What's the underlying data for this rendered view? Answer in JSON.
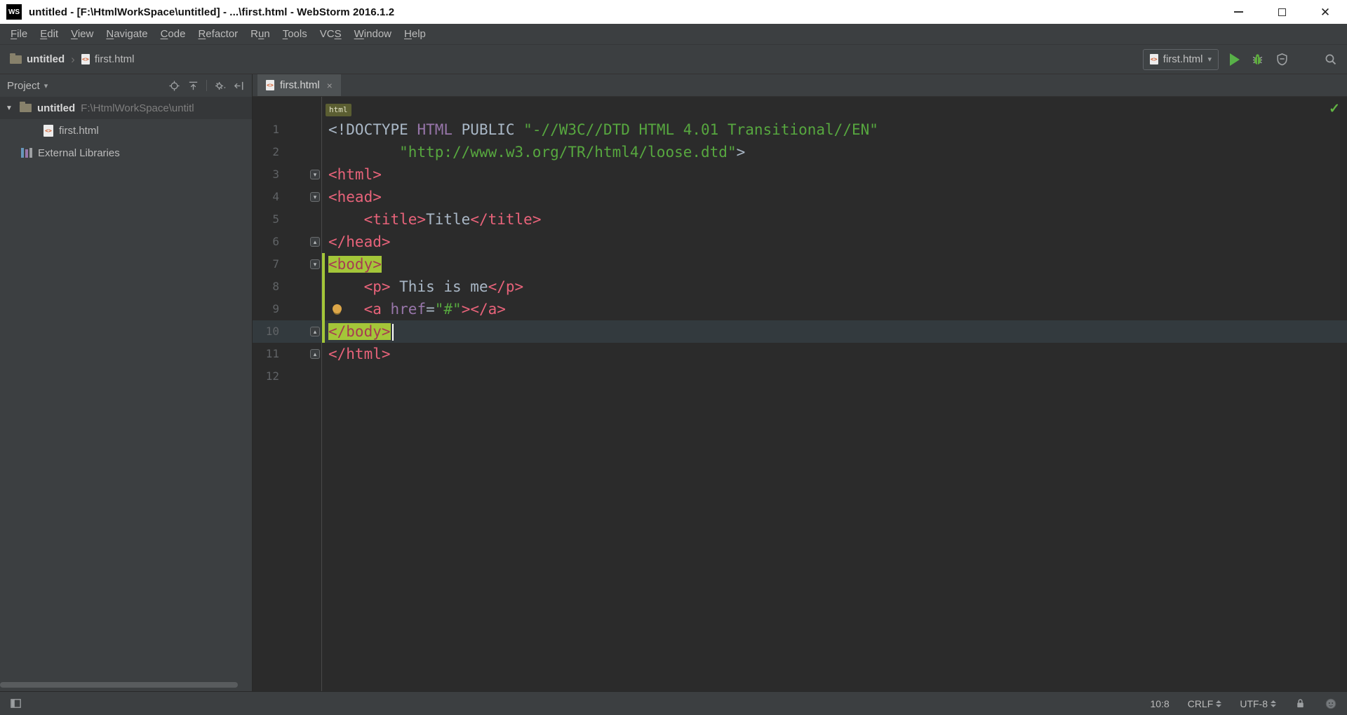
{
  "window": {
    "logo": "WS",
    "title": "untitled - [F:\\HtmlWorkSpace\\untitled] - ...\\first.html - WebStorm 2016.1.2"
  },
  "menu": {
    "items": [
      {
        "label": "File",
        "u": 0
      },
      {
        "label": "Edit",
        "u": 0
      },
      {
        "label": "View",
        "u": 0
      },
      {
        "label": "Navigate",
        "u": 0
      },
      {
        "label": "Code",
        "u": 0
      },
      {
        "label": "Refactor",
        "u": 0
      },
      {
        "label": "Run",
        "u": 1
      },
      {
        "label": "Tools",
        "u": 0
      },
      {
        "label": "VCS",
        "u": 2
      },
      {
        "label": "Window",
        "u": 0
      },
      {
        "label": "Help",
        "u": 0
      }
    ]
  },
  "navbar": {
    "breadcrumbs": [
      {
        "label": "untitled",
        "icon": "folder-icon"
      },
      {
        "label": "first.html",
        "icon": "html-file-icon"
      }
    ],
    "run_config": {
      "label": "first.html"
    }
  },
  "project": {
    "title": "Project",
    "tree": [
      {
        "name": "untitled",
        "path": "F:\\HtmlWorkSpace\\untitl",
        "type": "folder",
        "expanded": true,
        "selected": true
      },
      {
        "name": "first.html",
        "type": "html-file"
      },
      {
        "name": "External Libraries",
        "type": "library"
      }
    ]
  },
  "editor": {
    "tab": {
      "label": "first.html"
    },
    "breadcrumb": "html",
    "lines": [
      {
        "n": 1,
        "tokens": [
          [
            "<!DOCTYPE ",
            "pl"
          ],
          [
            "HTML",
            "kw"
          ],
          [
            " PUBLIC ",
            "pl"
          ],
          [
            "\"-//W3C//DTD HTML 4.01 Transitional//EN\"",
            "str"
          ]
        ]
      },
      {
        "n": 2,
        "tokens": [
          [
            "        ",
            "pl"
          ],
          [
            "\"http://www.w3.org/TR/html4/loose.dtd\"",
            "str"
          ],
          [
            ">",
            "pl"
          ]
        ]
      },
      {
        "n": 3,
        "fold": "open",
        "tokens": [
          [
            "<html>",
            "tag"
          ]
        ]
      },
      {
        "n": 4,
        "fold": "open",
        "tokens": [
          [
            "<head>",
            "tag"
          ]
        ]
      },
      {
        "n": 5,
        "tokens": [
          [
            "    ",
            "pl"
          ],
          [
            "<title>",
            "tag"
          ],
          [
            "Title",
            "pl"
          ],
          [
            "</title>",
            "tag"
          ]
        ]
      },
      {
        "n": 6,
        "fold": "close",
        "tokens": [
          [
            "</head>",
            "tag"
          ]
        ]
      },
      {
        "n": 7,
        "fold": "open",
        "bar": true,
        "tokens": [
          [
            "<body>",
            "hl"
          ]
        ]
      },
      {
        "n": 8,
        "bar": true,
        "tokens": [
          [
            "    ",
            "pl"
          ],
          [
            "<p>",
            "tag"
          ],
          [
            " This is me",
            "pl"
          ],
          [
            "</p>",
            "tag"
          ]
        ]
      },
      {
        "n": 9,
        "bar": true,
        "bulb": true,
        "tokens": [
          [
            "    ",
            "pl"
          ],
          [
            "<a ",
            "tag"
          ],
          [
            "href",
            "attr"
          ],
          [
            "=",
            "pl"
          ],
          [
            "\"#\"",
            "str"
          ],
          [
            "></a>",
            "tag"
          ]
        ]
      },
      {
        "n": 10,
        "fold": "close",
        "bar": true,
        "current": true,
        "caret": true,
        "tokens": [
          [
            "</body>",
            "hl"
          ]
        ]
      },
      {
        "n": 11,
        "fold": "close",
        "tokens": [
          [
            "</html>",
            "tag"
          ]
        ]
      },
      {
        "n": 12,
        "tokens": []
      }
    ]
  },
  "status": {
    "caret_position": "10:8",
    "line_separator": "CRLF",
    "encoding": "UTF-8"
  },
  "icons": {
    "close": "✕",
    "dropdown_arrow": "▾",
    "tree_expanded": "▼",
    "crumb_separator": "›",
    "tab_close": "×",
    "inspections_ok": "✓",
    "fold_open": "▾",
    "fold_close": "▴"
  },
  "colors": {
    "panel_bg": "#3c3f41",
    "editor_bg": "#2b2b2b",
    "plain": "#a9b7c6",
    "tag": "#e8637a",
    "keyword": "#9876aa",
    "string": "#57a73f",
    "highlight_bg": "#a4c639",
    "caret_line": "#333a3e",
    "line_number": "#606366",
    "run_green": "#58b148"
  }
}
